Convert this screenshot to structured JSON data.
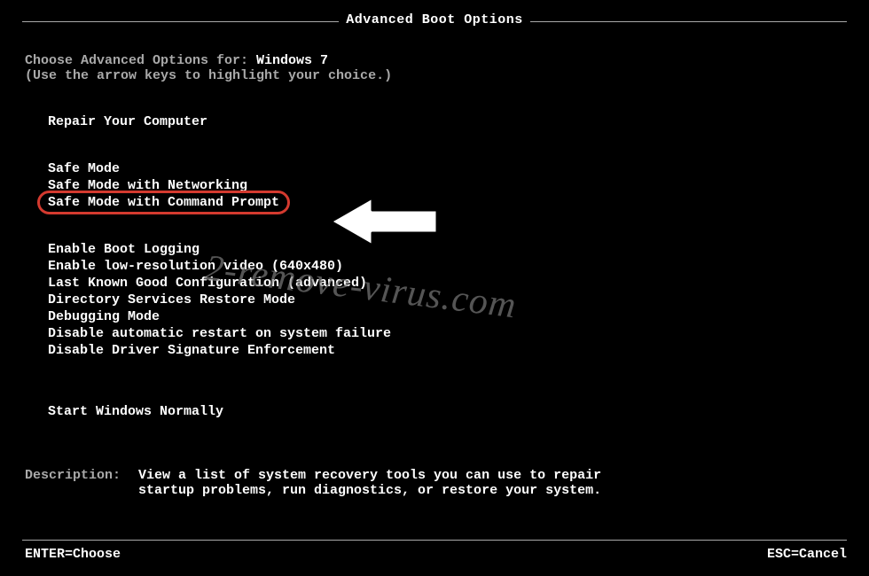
{
  "title": "Advanced Boot Options",
  "prompt_prefix": "Choose Advanced Options for: ",
  "os_name": "Windows 7",
  "hint": "(Use the arrow keys to highlight your choice.)",
  "groups": [
    {
      "items": [
        "Repair Your Computer"
      ]
    },
    {
      "items": [
        "Safe Mode",
        "Safe Mode with Networking",
        "Safe Mode with Command Prompt"
      ]
    },
    {
      "items": [
        "Enable Boot Logging",
        "Enable low-resolution video (640x480)",
        "Last Known Good Configuration (advanced)",
        "Directory Services Restore Mode",
        "Debugging Mode",
        "Disable automatic restart on system failure",
        "Disable Driver Signature Enforcement"
      ]
    },
    {
      "items": [
        "Start Windows Normally"
      ]
    }
  ],
  "highlighted_item": "Safe Mode with Command Prompt",
  "description_label": "Description:",
  "description_body": "View a list of system recovery tools you can use to repair\nstartup problems, run diagnostics, or restore your system.",
  "footer_left": "ENTER=Choose",
  "footer_right": "ESC=Cancel",
  "watermark": "2-remove-virus.com"
}
